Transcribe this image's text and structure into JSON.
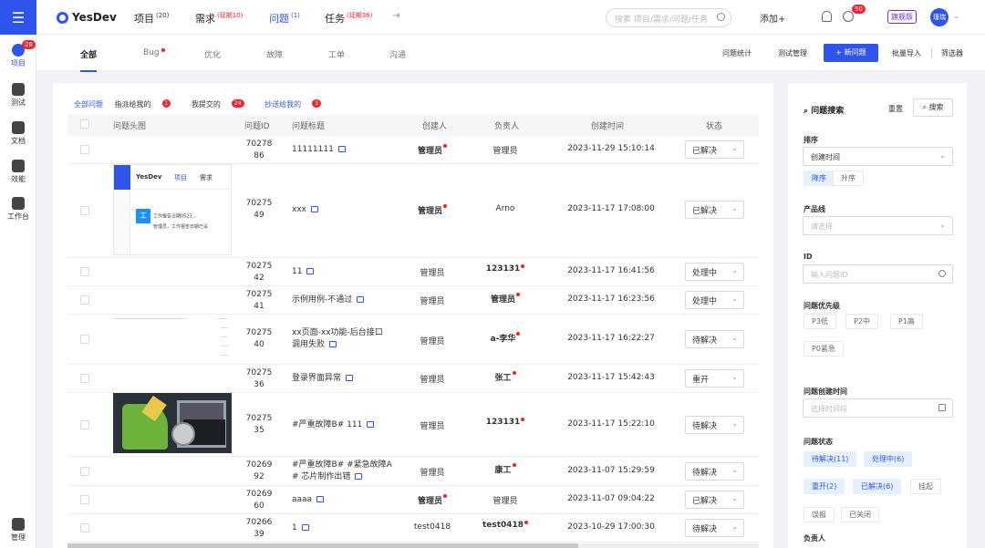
{
  "rail": {
    "items": [
      {
        "label": "项目",
        "badge": "28"
      },
      {
        "label": "测试"
      },
      {
        "label": "文档"
      },
      {
        "label": "效能"
      },
      {
        "label": "工作台"
      },
      {
        "label": "管理"
      }
    ]
  },
  "header": {
    "logo": "YesDev",
    "nav": [
      {
        "label": "项目",
        "count": "(20)"
      },
      {
        "label": "需求",
        "count": "(延期10)"
      },
      {
        "label": "问题",
        "count": "(1)"
      },
      {
        "label": "任务",
        "count": "(延期36)"
      }
    ],
    "search_placeholder": "搜索 项目/需求/问题/任务",
    "add_label": "添加+",
    "clock_badge": "50",
    "edition": "旗舰版",
    "avatar": "瑾瑞"
  },
  "tabs": [
    "全部",
    "Bug",
    "优化",
    "故障",
    "工单",
    "沟通"
  ],
  "actions": {
    "stats": "问题统计",
    "test_mgmt": "测试管理",
    "new_issue": "+ 新问题",
    "batch_import": "批量导入",
    "filter": "筛选器"
  },
  "quick_filters": [
    {
      "label": "全部问题"
    },
    {
      "label": "指派给我的",
      "count": "1"
    },
    {
      "label": "我提交的",
      "count": "24"
    },
    {
      "label": "抄送给我的",
      "count": "3"
    }
  ],
  "table": {
    "columns": [
      "问题头图",
      "问题ID",
      "问题标题",
      "创建人",
      "负责人",
      "创建时间",
      "状态"
    ],
    "rows": [
      {
        "id1": "70278",
        "id2": "86",
        "title": "11111111",
        "creator": "管理员",
        "owner": "管理员",
        "time": "2023-11-29 15:10:14",
        "status": "已解决"
      },
      {
        "id1": "70275",
        "id2": "49",
        "title": "xxx",
        "creator": "管理员",
        "owner": "Arno",
        "time": "2023-11-17 17:08:00",
        "status": "已解决",
        "thumb_logo": "YesDev",
        "thumb_nav1": "项目",
        "thumb_nav2": "需求",
        "thumb_title": "工作报告日期0523...",
        "thumb_sub": "管理员，工作报告日期已设",
        "thumb_icon": "工"
      },
      {
        "id1": "70275",
        "id2": "42",
        "title": "11",
        "creator": "管理员",
        "owner": "123131",
        "time": "2023-11-17 16:41:56",
        "status": "处理中"
      },
      {
        "id1": "70275",
        "id2": "41",
        "title": "示例用例-不通过",
        "creator": "管理员",
        "owner": "管理员",
        "time": "2023-11-17 16:23:56",
        "status": "处理中"
      },
      {
        "id1": "70275",
        "id2": "40",
        "title": "xx页面-xx功能-后台接口",
        "title2": "调用失败",
        "creator": "管理员",
        "owner": "a-李华",
        "time": "2023-11-17 16:22:27",
        "status": "待解决"
      },
      {
        "id1": "70275",
        "id2": "36",
        "title": "登录界面异常",
        "creator": "管理员",
        "owner": "张工",
        "time": "2023-11-17 15:42:43",
        "status": "重开"
      },
      {
        "id1": "70275",
        "id2": "35",
        "title": "#严重故障B# 111",
        "creator": "管理员",
        "owner": "123131",
        "time": "2023-11-17 15:22:10",
        "status": "待解决"
      },
      {
        "id1": "70269",
        "id2": "92",
        "title": "#严重故障B# #紧急故障A",
        "title2": "# 芯片制作出错",
        "creator": "管理员",
        "owner": "康工",
        "time": "2023-11-07 15:29:59",
        "status": "待解决"
      },
      {
        "id1": "70269",
        "id2": "60",
        "title": "aaaa",
        "creator": "管理员",
        "owner": "管理员",
        "time": "2023-11-07 09:04:22",
        "status": "已解决"
      },
      {
        "id1": "70266",
        "id2": "39",
        "title": "1",
        "creator": "test0418",
        "owner": "test0418",
        "time": "2023-10-29 17:00:30",
        "status": "待解决"
      }
    ]
  },
  "panel": {
    "title": "问题搜索",
    "reset": "重置",
    "search": "搜索",
    "sort_label": "排序",
    "sort_value": "创建时间",
    "sort_desc": "降序",
    "sort_asc": "升序",
    "product_label": "产品线",
    "product_placeholder": "请选择",
    "id_label": "ID",
    "id_placeholder": "输入问题ID",
    "priority_label": "问题优先级",
    "priorities": [
      "P3低",
      "P2中",
      "P1高",
      "P0紧急"
    ],
    "created_label": "问题创建时间",
    "created_placeholder": "选择时间段",
    "status_label": "问题状态",
    "statuses": [
      "待解决(11)",
      "处理中(6)",
      "重开(2)",
      "已解决(6)",
      "挂起",
      "误报",
      "已关闭"
    ],
    "owner_label": "负责人"
  }
}
